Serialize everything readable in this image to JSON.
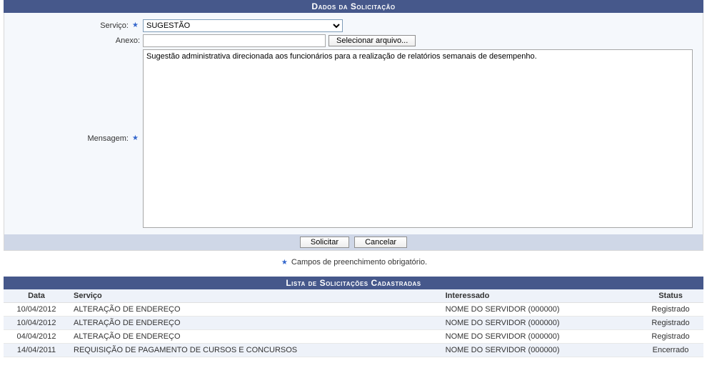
{
  "section1_title": "Dados da Solicitação",
  "form": {
    "servico_label": "Serviço:",
    "servico_value": "SUGESTÃO",
    "anexo_label": "Anexo:",
    "anexo_value": "",
    "file_button": "Selecionar arquivo...",
    "mensagem_label": "Mensagem:",
    "mensagem_value": "Sugestão administrativa direcionada aos funcionários para a realização de relatórios semanais de desempenho."
  },
  "buttons": {
    "solicitar": "Solicitar",
    "cancelar": "Cancelar"
  },
  "required_note": "Campos de preenchimento obrigatório.",
  "section2_title": "Lista de Solicitações Cadastradas",
  "table": {
    "headers": {
      "data": "Data",
      "servico": "Serviço",
      "interessado": "Interessado",
      "status": "Status"
    },
    "rows": [
      {
        "data": "10/04/2012",
        "servico": "ALTERAÇÃO DE ENDEREÇO",
        "interessado": "NOME DO SERVIDOR (000000)",
        "status": "Registrado"
      },
      {
        "data": "10/04/2012",
        "servico": "ALTERAÇÃO DE ENDEREÇO",
        "interessado": "NOME DO SERVIDOR (000000)",
        "status": "Registrado"
      },
      {
        "data": "04/04/2012",
        "servico": "ALTERAÇÃO DE ENDEREÇO",
        "interessado": "NOME DO SERVIDOR (000000)",
        "status": "Registrado"
      },
      {
        "data": "14/04/2011",
        "servico": "REQUISIÇÃO DE PAGAMENTO DE CURSOS E CONCURSOS",
        "interessado": "NOME DO SERVIDOR (000000)",
        "status": "Encerrado"
      }
    ]
  }
}
